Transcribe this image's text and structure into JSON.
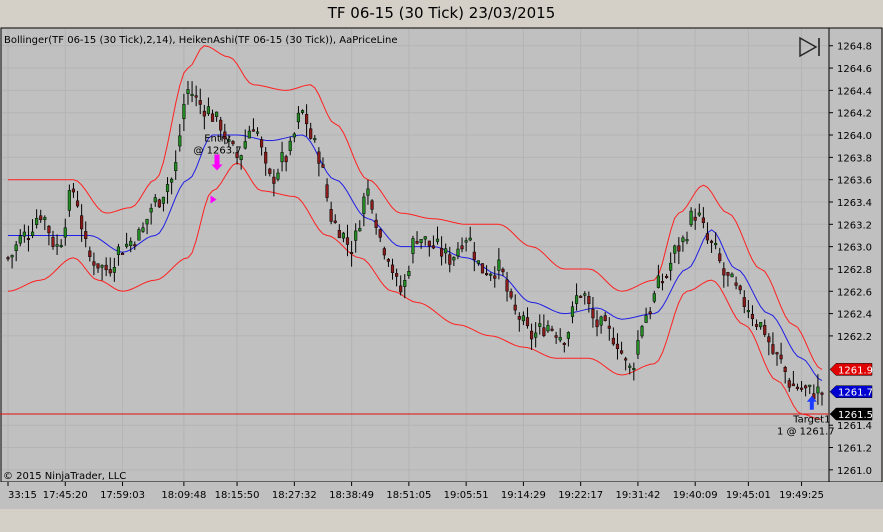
{
  "window": {
    "title": "TF 06-15 (30 Tick)  23/03/2015"
  },
  "indicators_label": "Bollinger(TF 06-15 (30 Tick),2,14), HeikenAshi(TF 06-15 (30 Tick)), AaPriceLine",
  "copyright": "© 2015 NinjaTrader, LLC",
  "colors": {
    "background": "#c0c0c0",
    "bull_candle": "#228b22",
    "bear_candle": "#8b1a1a",
    "bollinger_band": "#ff2020",
    "bollinger_mid": "#1e1ee6",
    "price_line": "#e01010",
    "entry_marker": "#ff00ff",
    "target_arrow": "#1e3cff"
  },
  "chart_data": {
    "type": "candlestick",
    "ylim": [
      1260.9,
      1264.95
    ],
    "y_ticks": [
      "1264.8",
      "1264.6",
      "1264.4",
      "1264.2",
      "1264.0",
      "1263.8",
      "1263.6",
      "1263.4",
      "1263.2",
      "1263.0",
      "1262.8",
      "1262.6",
      "1262.4",
      "1262.2",
      "1261.4",
      "1261.2",
      "1261.0"
    ],
    "x_ticks": [
      {
        "label": "33:15",
        "i": 0
      },
      {
        "label": "17:45:20",
        "i": 14
      },
      {
        "label": "17:59:03",
        "i": 28
      },
      {
        "label": "18:09:48",
        "i": 43
      },
      {
        "label": "18:15:50",
        "i": 56
      },
      {
        "label": "18:27:32",
        "i": 70
      },
      {
        "label": "18:38:49",
        "i": 84
      },
      {
        "label": "18:51:05",
        "i": 98
      },
      {
        "label": "19:05:51",
        "i": 112
      },
      {
        "label": "19:14:29",
        "i": 126
      },
      {
        "label": "19:22:17",
        "i": 140
      },
      {
        "label": "19:31:42",
        "i": 154
      },
      {
        "label": "19:40:09",
        "i": 168
      },
      {
        "label": "19:45:01",
        "i": 181
      },
      {
        "label": "19:49:25",
        "i": 194
      }
    ],
    "price_path": [
      [
        0,
        1262.9
      ],
      [
        4,
        1263.1
      ],
      [
        8,
        1263.3
      ],
      [
        12,
        1263.0
      ],
      [
        16,
        1263.5
      ],
      [
        20,
        1262.9
      ],
      [
        24,
        1262.8
      ],
      [
        28,
        1263.0
      ],
      [
        32,
        1263.1
      ],
      [
        36,
        1263.4
      ],
      [
        40,
        1263.6
      ],
      [
        44,
        1264.4
      ],
      [
        48,
        1264.25
      ],
      [
        52,
        1264.1
      ],
      [
        54,
        1263.9
      ],
      [
        56,
        1263.8
      ],
      [
        60,
        1264.1
      ],
      [
        64,
        1263.6
      ],
      [
        68,
        1263.8
      ],
      [
        72,
        1264.2
      ],
      [
        75,
        1263.9
      ],
      [
        80,
        1263.2
      ],
      [
        84,
        1263.0
      ],
      [
        88,
        1263.5
      ],
      [
        92,
        1263.0
      ],
      [
        96,
        1262.6
      ],
      [
        100,
        1263.1
      ],
      [
        104,
        1263.0
      ],
      [
        108,
        1262.9
      ],
      [
        112,
        1263.1
      ],
      [
        116,
        1262.8
      ],
      [
        120,
        1262.8
      ],
      [
        124,
        1262.4
      ],
      [
        128,
        1262.2
      ],
      [
        132,
        1262.3
      ],
      [
        136,
        1262.2
      ],
      [
        140,
        1262.6
      ],
      [
        144,
        1262.3
      ],
      [
        148,
        1262.2
      ],
      [
        152,
        1261.9
      ],
      [
        156,
        1262.4
      ],
      [
        160,
        1262.7
      ],
      [
        164,
        1263.0
      ],
      [
        168,
        1263.3
      ],
      [
        172,
        1263.0
      ],
      [
        176,
        1262.7
      ],
      [
        180,
        1262.5
      ],
      [
        184,
        1262.3
      ],
      [
        188,
        1262.0
      ],
      [
        192,
        1261.75
      ],
      [
        196,
        1261.7
      ],
      [
        199,
        1261.7
      ]
    ],
    "mid_path": [
      [
        0,
        1263.1
      ],
      [
        10,
        1263.1
      ],
      [
        20,
        1263.1
      ],
      [
        28,
        1262.95
      ],
      [
        36,
        1263.1
      ],
      [
        44,
        1263.6
      ],
      [
        50,
        1264.0
      ],
      [
        56,
        1264.0
      ],
      [
        64,
        1263.95
      ],
      [
        72,
        1264.0
      ],
      [
        80,
        1263.6
      ],
      [
        88,
        1263.25
      ],
      [
        96,
        1263.0
      ],
      [
        104,
        1263.0
      ],
      [
        112,
        1262.9
      ],
      [
        120,
        1262.75
      ],
      [
        128,
        1262.5
      ],
      [
        136,
        1262.4
      ],
      [
        144,
        1262.45
      ],
      [
        150,
        1262.35
      ],
      [
        158,
        1262.4
      ],
      [
        166,
        1262.8
      ],
      [
        172,
        1263.15
      ],
      [
        178,
        1262.8
      ],
      [
        186,
        1262.4
      ],
      [
        194,
        1262.0
      ],
      [
        199,
        1261.8
      ]
    ],
    "upper_path": [
      [
        0,
        1263.6
      ],
      [
        8,
        1263.6
      ],
      [
        16,
        1263.6
      ],
      [
        24,
        1263.3
      ],
      [
        30,
        1263.35
      ],
      [
        36,
        1263.6
      ],
      [
        44,
        1264.6
      ],
      [
        48,
        1264.8
      ],
      [
        54,
        1264.7
      ],
      [
        60,
        1264.45
      ],
      [
        68,
        1264.4
      ],
      [
        74,
        1264.45
      ],
      [
        80,
        1264.1
      ],
      [
        88,
        1263.6
      ],
      [
        96,
        1263.3
      ],
      [
        104,
        1263.25
      ],
      [
        112,
        1263.2
      ],
      [
        120,
        1263.2
      ],
      [
        128,
        1263.0
      ],
      [
        136,
        1262.8
      ],
      [
        142,
        1262.8
      ],
      [
        150,
        1262.6
      ],
      [
        158,
        1262.7
      ],
      [
        164,
        1263.3
      ],
      [
        170,
        1263.55
      ],
      [
        176,
        1263.3
      ],
      [
        184,
        1262.8
      ],
      [
        192,
        1262.3
      ],
      [
        199,
        1261.9
      ]
    ],
    "lower_path": [
      [
        0,
        1262.6
      ],
      [
        8,
        1262.7
      ],
      [
        16,
        1262.9
      ],
      [
        22,
        1262.7
      ],
      [
        28,
        1262.6
      ],
      [
        36,
        1262.7
      ],
      [
        44,
        1262.9
      ],
      [
        50,
        1263.5
      ],
      [
        56,
        1263.75
      ],
      [
        62,
        1263.5
      ],
      [
        70,
        1263.45
      ],
      [
        78,
        1263.1
      ],
      [
        86,
        1262.9
      ],
      [
        94,
        1262.6
      ],
      [
        100,
        1262.5
      ],
      [
        110,
        1262.3
      ],
      [
        118,
        1262.2
      ],
      [
        126,
        1262.1
      ],
      [
        134,
        1262.0
      ],
      [
        142,
        1262.0
      ],
      [
        150,
        1261.85
      ],
      [
        158,
        1261.95
      ],
      [
        166,
        1262.6
      ],
      [
        172,
        1262.7
      ],
      [
        180,
        1262.3
      ],
      [
        188,
        1261.8
      ],
      [
        194,
        1261.5
      ],
      [
        199,
        1261.45
      ]
    ],
    "price_line_value": 1261.5,
    "right_tags": [
      {
        "label": "1261.9",
        "value": 1261.9,
        "bg": "#e00000",
        "fg": "#ffffff"
      },
      {
        "label": "1261.7",
        "value": 1261.7,
        "bg": "#0000d0",
        "fg": "#ffffff"
      },
      {
        "label": "1261.5",
        "value": 1261.5,
        "bg": "#000000",
        "fg": "#ffffff"
      }
    ],
    "entry_annotation": {
      "line1": "Entry",
      "line2": "@ 1263.7",
      "i": 50,
      "price": 1263.7
    },
    "target_annotation": {
      "line1": "Target1",
      "line2": "1 @ 1261.7",
      "i": 197,
      "price": 1261.7
    }
  }
}
